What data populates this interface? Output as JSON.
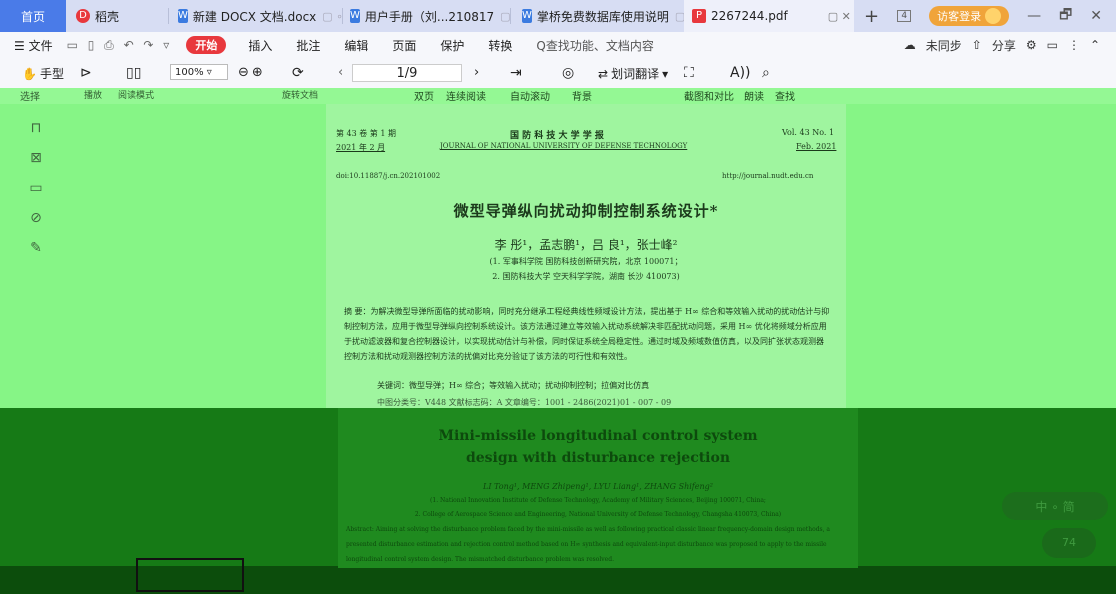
{
  "tabs": {
    "home": "首页",
    "t1": "稻壳",
    "t2": "新建 DOCX 文档.docx",
    "t3": "用户手册（刘...210817",
    "t4": "掌桥免费数据库使用说明",
    "t5": "2267244.pdf",
    "new_tab": "+"
  },
  "window": {
    "visitor": "访客登录",
    "minimize": "—",
    "restore": "🗗",
    "close": "✕",
    "layout_icon": "4"
  },
  "menu": {
    "file": "☰ 文件",
    "start": "开始",
    "insert": "插入",
    "annotate": "批注",
    "edit": "编辑",
    "page": "页面",
    "protect": "保护",
    "convert": "转换",
    "search": "Q查找功能、文档内容",
    "unsynced": "未同步",
    "share": "分享"
  },
  "toolbar": {
    "hand": "手型",
    "select": "选择",
    "zoom": "100%",
    "page_display": "1/9",
    "translate": "划词翻译",
    "double": "双页",
    "continuous": "连续阅读",
    "autoscroll": "自动滚动",
    "background": "背景",
    "compare": "截图和对比",
    "read": "朗读",
    "find": "查找",
    "play": "播放",
    "read_mode": "阅读模式",
    "rotate": "旋转文档"
  },
  "doc": {
    "vol_cn": "第 43 卷 第 1 期",
    "date_cn": "2021 年 2 月",
    "journal_cn": "国 防 科 技 大 学 学 报",
    "journal_en": "JOURNAL OF NATIONAL UNIVERSITY OF DEFENSE TECHNOLOGY",
    "vol_en": "Vol. 43 No. 1",
    "date_en": "Feb. 2021",
    "doi": "doi:10.11887/j.cn.202101002",
    "url": "http://journal.nudt.edu.cn",
    "title": "微型导弹纵向扰动抑制控制系统设计*",
    "authors": "李 彤¹，孟志鹏¹，吕 良¹，张士峰²",
    "aff1": "(1. 军事科学院 国防科技创新研究院，北京 100071；",
    "aff2": "2. 国防科技大学 空天科学学院，湖南 长沙 410073)",
    "abstract": "摘 要：为解决微型导弹所面临的扰动影响，同时充分继承工程经典线性频域设计方法，提出基于 H∞ 综合和等效输入扰动的扰动估计与抑制控制方法，应用于微型导弹纵向控制系统设计。该方法通过建立等效输入扰动系统解决非匹配扰动问题，采用 H∞ 优化将频域分析应用于扰动滤波器和复合控制器设计，以实现扰动估计与补偿，同时保证系统全局稳定性。通过时域及频域数值仿真，以及同扩张状态观测器控制方法和扰动观测器控制方法的扰偏对比充分验证了该方法的可行性和有效性。",
    "keywords": "关键词：微型导弹；H∞ 综合；等效输入扰动；扰动抑制控制；拉偏对比仿真",
    "classify": "中图分类号：V448        文献标志码：A        文章编号：1001 - 2486(2021)01 - 007 - 09",
    "en_title1": "Mini-missile longitudinal control system",
    "en_title2": "design with disturbance rejection",
    "en_authors": "LI Tong¹, MENG Zhipeng¹, LYU Liang¹, ZHANG Shifeng²",
    "en_aff1": "(1. National Innovation Institute of Defense Technology, Academy of Military Sciences, Beijing 100071, China;",
    "en_aff2": "2. College of Aerospace Science and Engineering, National University of Defense Technology, Changsha 410073, China)",
    "en_abstract": "Abstract: Aiming at solving the disturbance problem faced by the mini-missile as well as following practical classic linear frequency-domain design methods, a presented disturbance estimation and rejection control method based on H∞ synthesis and equivalent-input disturbance was proposed to apply to the missile longitudinal control system design. The mismatched disturbance problem was resolved."
  },
  "widget": {
    "label": "中 ∘ 简",
    "circle": "74"
  },
  "colors": {
    "tab_bar": "#d7ddf3",
    "home_tab": "#4a7be8",
    "start_button": "#e8383d",
    "overlay_green": "#86f586",
    "dark_green": "#167a16"
  }
}
